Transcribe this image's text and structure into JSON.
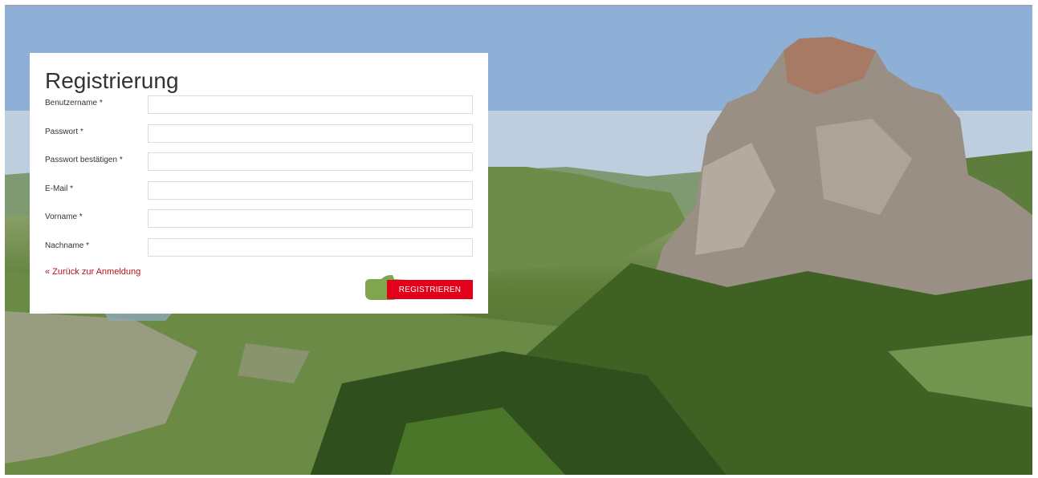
{
  "form": {
    "title": "Registrierung",
    "fields": [
      {
        "label": "Benutzername *",
        "value": "",
        "placeholder": ""
      },
      {
        "label": "Passwort *",
        "value": "",
        "placeholder": ""
      },
      {
        "label": "Passwort bestätigen *",
        "value": "",
        "placeholder": ""
      },
      {
        "label": "E-Mail *",
        "value": "",
        "placeholder": ""
      },
      {
        "label": "Vorname *",
        "value": "",
        "placeholder": ""
      },
      {
        "label": "Nachname *",
        "value": "",
        "placeholder": ""
      }
    ],
    "back_link": "« Zurück zur Anmeldung",
    "submit_label": "REGISTRIEREN"
  },
  "colors": {
    "accent": "#e2001a",
    "link": "#b5121b",
    "pointer_hand": "#7fa64e"
  },
  "icons": {
    "pointer": "pointing-hand-icon",
    "background": "mountain-landscape"
  }
}
